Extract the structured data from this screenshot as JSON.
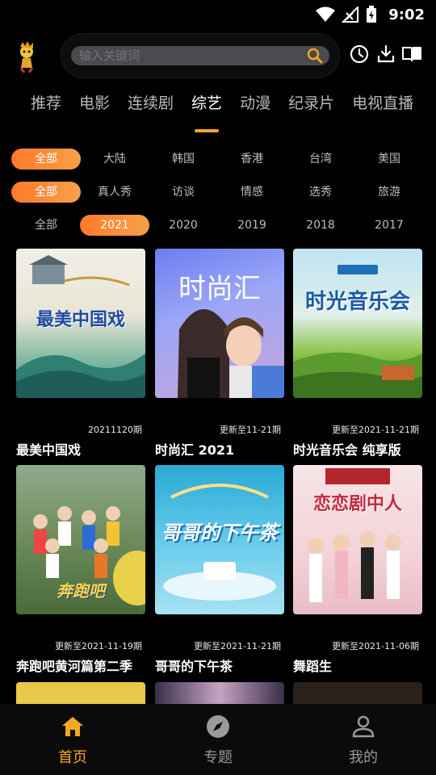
{
  "status": {
    "time": "9:02"
  },
  "search": {
    "placeholder": "输入关键词"
  },
  "tabs": [
    {
      "label": "推荐"
    },
    {
      "label": "电影"
    },
    {
      "label": "连续剧"
    },
    {
      "label": "综艺"
    },
    {
      "label": "动漫"
    },
    {
      "label": "纪录片"
    },
    {
      "label": "电视直播"
    }
  ],
  "active_tab": "综艺",
  "filters": {
    "region": [
      "全部",
      "大陆",
      "韩国",
      "香港",
      "台湾",
      "美国"
    ],
    "genre": [
      "全部",
      "真人秀",
      "访谈",
      "情感",
      "选秀",
      "旅游"
    ],
    "year": [
      "全部",
      "2021",
      "2020",
      "2019",
      "2018",
      "2017"
    ]
  },
  "filter_selected": {
    "region": "全部",
    "genre": "全部",
    "year": "2021"
  },
  "cards": [
    {
      "title": "最美中国戏",
      "meta": "20211120期",
      "poster_text": "最美中国戏"
    },
    {
      "title": "时尚汇 2021",
      "meta": "更新至11-21期",
      "poster_text": "时尚汇"
    },
    {
      "title": "时光音乐会 纯享版",
      "meta": "更新至2021-11-21期",
      "poster_text": "时光音乐会"
    },
    {
      "title": "奔跑吧黄河篇第二季",
      "meta": "更新至2021-11-19期",
      "poster_text": "奔跑吧"
    },
    {
      "title": "哥哥的下午茶",
      "meta": "更新至2021-11-21期",
      "poster_text": "哥哥的下午茶"
    },
    {
      "title": "舞蹈生",
      "meta": "更新至2021-11-06期",
      "poster_text": "恋恋剧中人"
    }
  ],
  "bottom_nav": [
    {
      "label": "首页",
      "icon": "home-icon"
    },
    {
      "label": "专题",
      "icon": "compass-icon"
    },
    {
      "label": "我的",
      "icon": "user-icon"
    }
  ],
  "colors": {
    "accent": "#f5a623",
    "background": "#000000"
  }
}
